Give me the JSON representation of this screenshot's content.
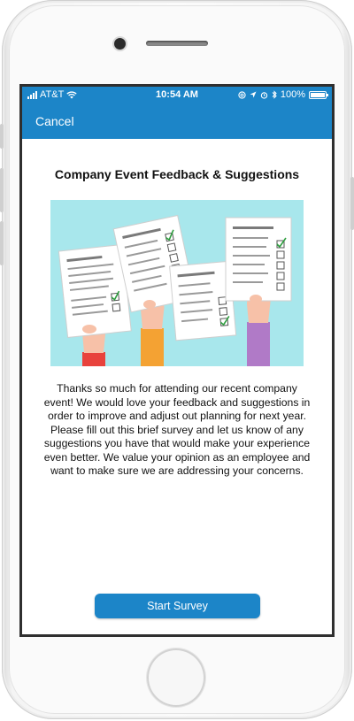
{
  "status_bar": {
    "carrier": "AT&T",
    "time": "10:54 AM",
    "battery": "100%",
    "icons": [
      "signal-icon",
      "wifi-icon",
      "at-icon",
      "location-icon",
      "alarm-icon",
      "bluetooth-icon",
      "battery-icon"
    ]
  },
  "nav": {
    "cancel_label": "Cancel"
  },
  "content": {
    "title": "Company Event Feedback & Suggestions",
    "body": "Thanks so much for attending our recent company event! We would love your feedback and suggestions in order to improve and adjust out planning for next year. Please fill out this brief survey and let us know of any suggestions you have that would make your experience even better. We value your opinion as an employee and want to make sure we are addressing your concerns.",
    "start_label": "Start Survey"
  },
  "colors": {
    "accent": "#1c85c8",
    "hero_bg": "#a8e7ec",
    "sleeve_red": "#e8423c",
    "sleeve_orange": "#f4a233",
    "sleeve_purple": "#b07ac7",
    "check_green": "#2e9e3f"
  }
}
